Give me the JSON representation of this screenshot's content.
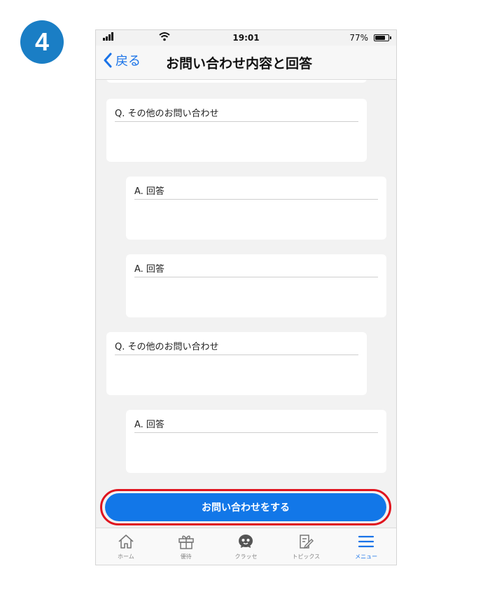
{
  "step_number": "4",
  "status_bar": {
    "time": "19:01",
    "battery": "77%"
  },
  "nav": {
    "back_label": "戻る",
    "title": "お問い合わせ内容と回答"
  },
  "thread": [
    {
      "type": "question",
      "label": "Q. その他のお問い合わせ"
    },
    {
      "type": "answer",
      "label": "A. 回答"
    },
    {
      "type": "answer",
      "label": "A. 回答"
    },
    {
      "type": "question",
      "label": "Q. その他のお問い合わせ"
    },
    {
      "type": "answer",
      "label": "A. 回答"
    }
  ],
  "cta": {
    "label": "お問い合わせをする",
    "highlight_color": "#e0141e",
    "button_color": "#1277e8"
  },
  "tabs": [
    {
      "label": "ホーム",
      "icon": "home-icon"
    },
    {
      "label": "優待",
      "icon": "gift-icon"
    },
    {
      "label": "クラッセ",
      "icon": "mascot-icon"
    },
    {
      "label": "トピックス",
      "icon": "notes-edit-icon"
    },
    {
      "label": "メニュー",
      "icon": "hamburger-menu-icon",
      "active": true
    }
  ],
  "accent_color": "#1a73e8"
}
